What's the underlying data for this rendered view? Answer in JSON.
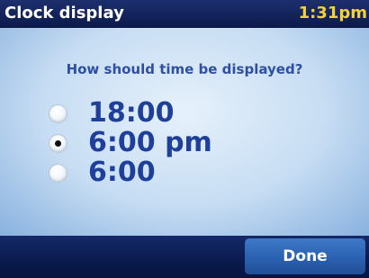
{
  "header": {
    "title": "Clock display",
    "time": "1:31pm"
  },
  "question": "How should time be displayed?",
  "options": [
    {
      "label": "18:00",
      "selected": false
    },
    {
      "label": "6:00 pm",
      "selected": true
    },
    {
      "label": "6:00",
      "selected": false
    }
  ],
  "footer": {
    "done_label": "Done"
  },
  "colors": {
    "title_text": "#ffffff",
    "clock_text": "#f1d23a",
    "question_text": "#2f4fa3",
    "option_text": "#1e3f9a",
    "bar_background": "#0c1a4c",
    "button_background": "#2c63b3"
  }
}
